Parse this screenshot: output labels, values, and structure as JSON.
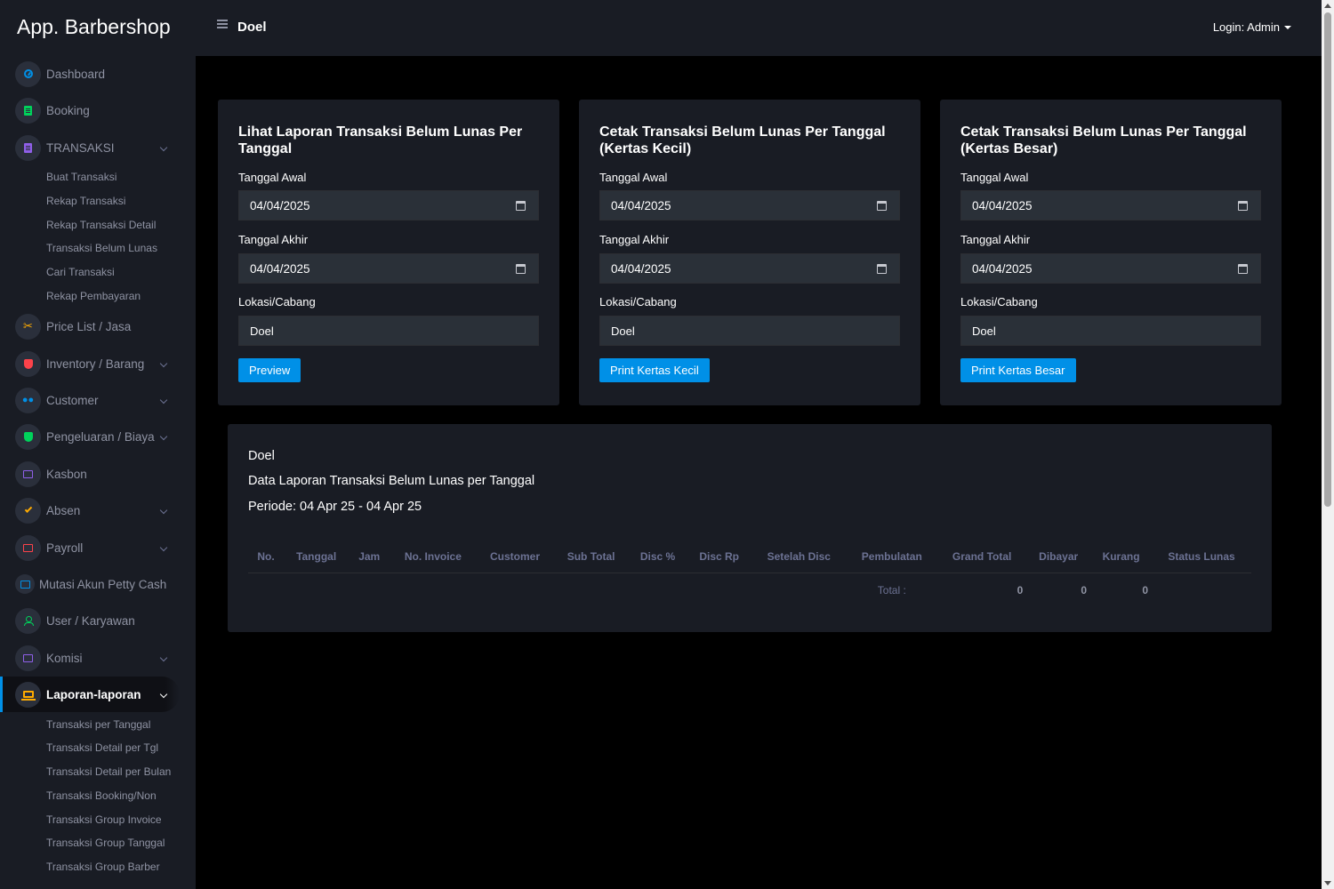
{
  "app": {
    "brand": "App. Barbershop",
    "page_title": "Doel",
    "login": "Login: Admin"
  },
  "sidebar": {
    "items": [
      {
        "label": "Dashboard",
        "icon": "gauge-icon"
      },
      {
        "label": "Booking",
        "icon": "document-icon"
      },
      {
        "label": "TRANSAKSI",
        "icon": "document-icon",
        "subitems": [
          "Buat Transaksi",
          "Rekap Transaksi",
          "Rekap Transaksi Detail",
          "Transaksi Belum Lunas",
          "Cari Transaksi",
          "Rekap Pembayaran"
        ]
      },
      {
        "label": "Price List / Jasa",
        "icon": "scissors-icon"
      },
      {
        "label": "Inventory / Barang",
        "icon": "shield-icon"
      },
      {
        "label": "Customer",
        "icon": "people-icon"
      },
      {
        "label": "Pengeluaran / Biaya",
        "icon": "shield-icon"
      },
      {
        "label": "Kasbon",
        "icon": "cash-icon"
      },
      {
        "label": "Absen",
        "icon": "check-icon"
      },
      {
        "label": "Payroll",
        "icon": "cash-icon"
      },
      {
        "label": "Mutasi Akun Petty Cash",
        "icon": "cash-icon"
      },
      {
        "label": "User / Karyawan",
        "icon": "user-icon"
      },
      {
        "label": "Komisi",
        "icon": "cash-icon"
      },
      {
        "label": "Laporan-laporan",
        "icon": "laptop-icon",
        "subitems": [
          "Transaksi per Tanggal",
          "Transaksi Detail per Tgl",
          "Transaksi Detail per Bulan",
          "Transaksi Booking/Non",
          "Transaksi Group Invoice",
          "Transaksi Group Tanggal",
          "Transaksi Group Barber"
        ]
      }
    ]
  },
  "cards": [
    {
      "title": "Lihat Laporan Transaksi Belum Lunas Per Tanggal",
      "start_label": "Tanggal Awal",
      "start_value": "04/04/2025",
      "end_label": "Tanggal Akhir",
      "end_value": "04/04/2025",
      "location_label": "Lokasi/Cabang",
      "location_value": "Doel",
      "button": "Preview"
    },
    {
      "title": "Cetak Transaksi Belum Lunas Per Tanggal (Kertas Kecil)",
      "start_label": "Tanggal Awal",
      "start_value": "04/04/2025",
      "end_label": "Tanggal Akhir",
      "end_value": "04/04/2025",
      "location_label": "Lokasi/Cabang",
      "location_value": "Doel",
      "button": "Print Kertas Kecil"
    },
    {
      "title": "Cetak Transaksi Belum Lunas Per Tanggal (Kertas Besar)",
      "start_label": "Tanggal Awal",
      "start_value": "04/04/2025",
      "end_label": "Tanggal Akhir",
      "end_value": "04/04/2025",
      "location_label": "Lokasi/Cabang",
      "location_value": "Doel",
      "button": "Print Kertas Besar"
    }
  ],
  "report": {
    "location": "Doel",
    "title": "Data Laporan Transaksi Belum Lunas per Tanggal",
    "period": "Periode: 04 Apr 25 - 04 Apr 25",
    "columns": [
      "No.",
      "Tanggal",
      "Jam",
      "No. Invoice",
      "Customer",
      "Sub Total",
      "Disc %",
      "Disc Rp",
      "Setelah Disc",
      "Pembulatan",
      "Grand Total",
      "Dibayar",
      "Kurang",
      "Status Lunas"
    ],
    "total_label": "Total :",
    "totals": {
      "grand_total": "0",
      "dibayar": "0",
      "kurang": "0"
    }
  }
}
